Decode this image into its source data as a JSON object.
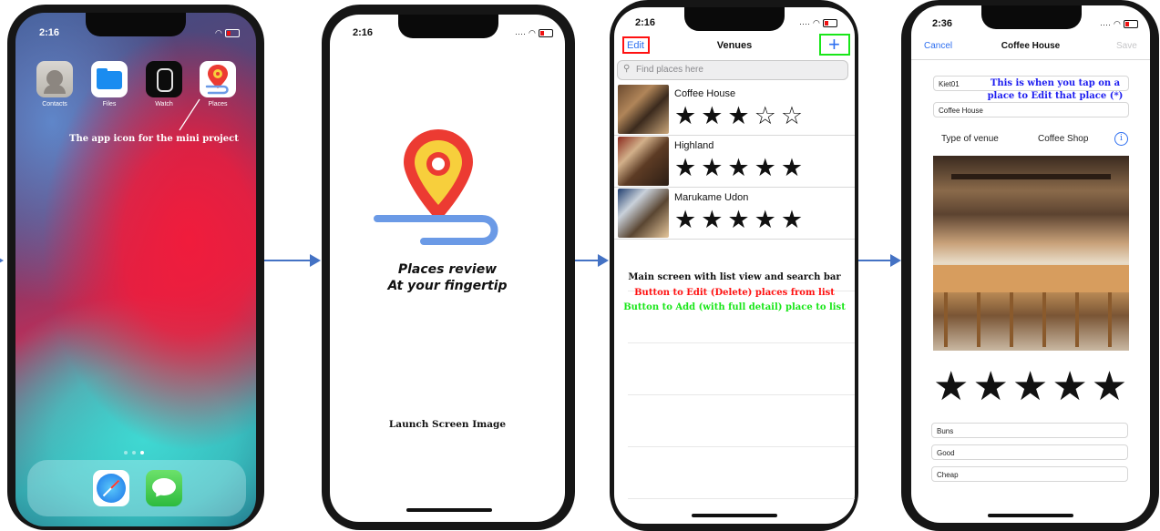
{
  "colors": {
    "arrow": "#4472c4",
    "ios_blue": "#2e6ff0",
    "edit_red": "#ff1111",
    "add_green": "#19e619",
    "note_blue": "#1d1df0",
    "marker_red": "#ec3b32",
    "marker_yellow": "#f7cf3c",
    "path_blue": "#6b9ae6"
  },
  "phone1": {
    "time": "2:16",
    "apps": [
      {
        "label": "Contacts",
        "icon": "contacts-icon"
      },
      {
        "label": "Files",
        "icon": "files-icon"
      },
      {
        "label": "Watch",
        "icon": "watch-icon"
      },
      {
        "label": "Places",
        "icon": "places-icon"
      }
    ],
    "caption": "The app icon for the mini project",
    "dock": [
      "safari-icon",
      "messages-icon"
    ]
  },
  "phone2": {
    "time": "2:16",
    "tagline_1": "Places review",
    "tagline_2": "At your fingertip",
    "caption": "Launch Screen Image"
  },
  "phone3": {
    "time": "2:16",
    "nav_title": "Venues",
    "edit_label": "Edit",
    "add_label": "+",
    "search_placeholder": "Find places here",
    "venues": [
      {
        "name": "Coffee House",
        "rating": 3,
        "stars": "★★★☆☆"
      },
      {
        "name": "Highland",
        "rating": 5,
        "stars": "★★★★★"
      },
      {
        "name": "Marukame Udon",
        "rating": 5,
        "stars": "★★★★★"
      }
    ],
    "note_1": "Main screen with list view and search bar",
    "note_2": "Button to Edit (Delete) places from list",
    "note_3": "Button to Add (with full detail) place to list"
  },
  "phone4": {
    "time": "2:36",
    "cancel_label": "Cancel",
    "nav_title": "Coffee House",
    "save_label": "Save",
    "field_user": "Kiet01",
    "field_name": "Coffee House",
    "note": "This is when you tap on a place to Edit that place (*)",
    "type_label": "Type of venue",
    "type_value": "Coffee Shop",
    "rating": 5,
    "stars": "★★★★★",
    "review_fields": [
      "Buns",
      "Good",
      "Cheap"
    ]
  }
}
